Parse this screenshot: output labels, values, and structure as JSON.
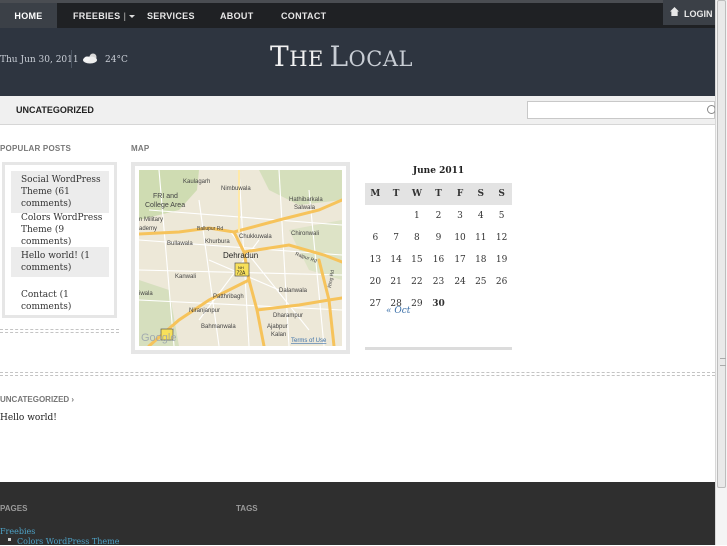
{
  "nav": {
    "items": [
      {
        "label": "HOME",
        "active": true
      },
      {
        "label": "FREEBIES",
        "separator": "|",
        "has_dropdown": true
      },
      {
        "label": "SERVICES"
      },
      {
        "label": "ABOUT"
      },
      {
        "label": "CONTACT"
      }
    ],
    "login_label": "LOGIN"
  },
  "header": {
    "date": "Thu Jun 30, 2011",
    "temperature": "24°C",
    "weather_icon": "cloud-sun-icon",
    "logo_the_big": "T",
    "logo_the_small": "HE",
    "logo_local_big": "L",
    "logo_local_small": "OCAL"
  },
  "category_bar": {
    "title": "UNCATEGORIZED",
    "search_placeholder": ""
  },
  "popular_posts": {
    "title": "POPULAR POSTS",
    "items": [
      {
        "text": "Social WordPress Theme (61 comments)"
      },
      {
        "text": "Colors WordPress Theme (9 comments)"
      },
      {
        "text": "Hello world! (1 comments)"
      },
      {
        "text": "Contact (1 comments)"
      }
    ]
  },
  "map_widget": {
    "title": "MAP",
    "labels": {
      "kaulagarh": "Kaulagarh",
      "fri": "FRI and",
      "college_area": "College Area",
      "nimbuwala": "Nimbuwala",
      "hathibarkala": "Hathibarkala",
      "salwala": "Salwala",
      "military": "n Military",
      "academy": "ademy",
      "ballupur": "Ballupur Rd",
      "chukkuwala": "Chukkuwala",
      "chironwali": "Chironwali",
      "bullawala": "Bullawala",
      "khurbura": "Khurbura",
      "dehradun": "Dehradun",
      "rajpur": "Rajpur Rd",
      "kanwali": "Kanwali",
      "nh72a_top": "NH",
      "nh72a": "72A",
      "dalanwala": "Dalanwala",
      "pathribagh": "Patthribagh",
      "iwala": "iwala",
      "ring_road": "Ring Rd",
      "niranjanpur": "Niranjanpur",
      "dharampur": "Dharampur",
      "bahmanwala": "Bahmanwala",
      "ajabpur": "Ajabpur",
      "kalan": "Kalan",
      "google": "Google",
      "terms": "Terms of Use"
    }
  },
  "calendar": {
    "caption": "June 2011",
    "weekdays": [
      "M",
      "T",
      "W",
      "T",
      "F",
      "S",
      "S"
    ],
    "weeks": [
      [
        "",
        "",
        "1",
        "2",
        "3",
        "4",
        "5"
      ],
      [
        "6",
        "7",
        "8",
        "9",
        "10",
        "11",
        "12"
      ],
      [
        "13",
        "14",
        "15",
        "16",
        "17",
        "18",
        "19"
      ],
      [
        "20",
        "21",
        "22",
        "23",
        "24",
        "25",
        "26"
      ],
      [
        "27",
        "28",
        "29",
        "30",
        "",
        "",
        ""
      ]
    ],
    "today": "30",
    "prev_link": "« Oct"
  },
  "post": {
    "category": "UNCATEGORIZED ›",
    "title": "Hello world!"
  },
  "footer": {
    "pages_title": "PAGES",
    "tags_title": "TAGS",
    "pages": [
      "Freebies",
      "Colors WordPress Theme"
    ]
  },
  "colors": {
    "top_nav": "#1f2124",
    "header": "#2e3540",
    "footer": "#2f2f2f",
    "link": "#3a6fa8"
  }
}
